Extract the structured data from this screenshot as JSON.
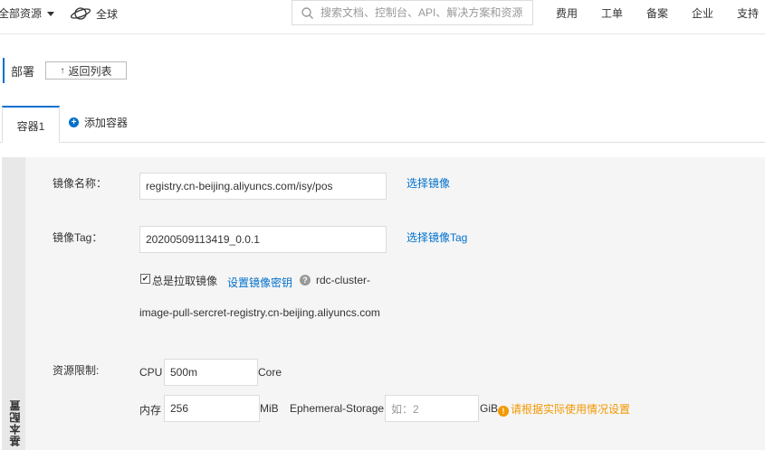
{
  "topbar": {
    "all_resources": "全部资源",
    "region": "全球",
    "search_placeholder": "搜索文档、控制台、API、解决方案和资源",
    "nav": [
      "费用",
      "工单",
      "备案",
      "企业",
      "支持"
    ]
  },
  "header": {
    "title": "部署",
    "back_label": "返回列表"
  },
  "tabs": {
    "active": "容器1",
    "add_label": "添加容器"
  },
  "panel": {
    "section_label": "基本配置",
    "image_name": {
      "label": "镜像名称：",
      "value": "registry.cn-beijing.aliyuncs.com/isy/pos",
      "link": "选择镜像"
    },
    "image_tag": {
      "label": "镜像Tag：",
      "value": "20200509113419_0.0.1",
      "link": "选择镜像Tag"
    },
    "pull": {
      "checked": true,
      "label": "总是拉取镜像",
      "secret_link": "设置镜像密钥",
      "secret_line1": "rdc-cluster-",
      "secret_line2": "image-pull-sercret-registry.cn-beijing.aliyuncs.com"
    },
    "resources": {
      "label": "资源限制:",
      "cpu_label": "CPU",
      "cpu_value": "500m",
      "cpu_unit": "Core",
      "mem_label": "内存",
      "mem_value": "256",
      "mem_unit": "MiB",
      "eph_label": "Ephemeral-Storage",
      "eph_placeholder": "如：2",
      "eph_unit": "GiB",
      "warn_text": "请根据实际使用情况设置"
    }
  },
  "colors": {
    "accent": "#0070cc",
    "warning": "#f39800",
    "panel_bg": "#f5f5f5"
  }
}
